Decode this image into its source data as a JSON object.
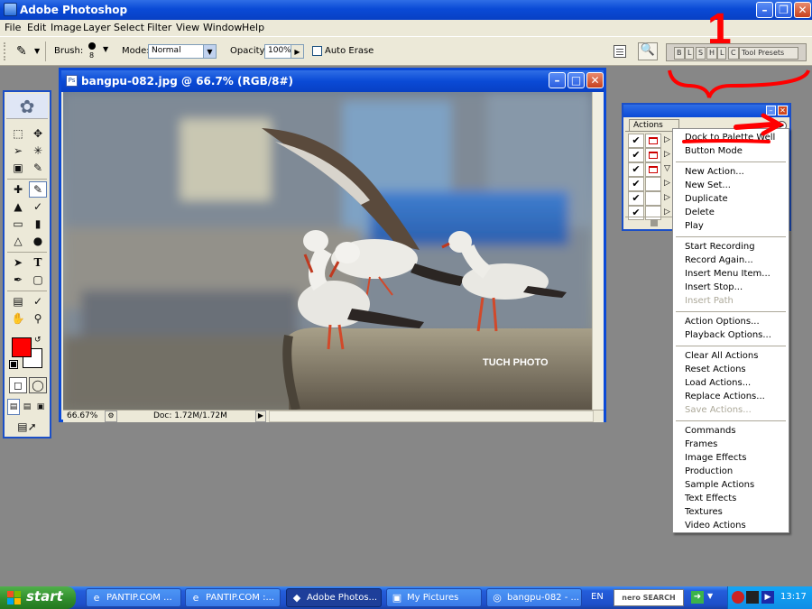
{
  "app": {
    "title": "Adobe Photoshop"
  },
  "menubar": [
    "File",
    "Edit",
    "Image",
    "Layer",
    "Select",
    "Filter",
    "View",
    "Window",
    "Help"
  ],
  "options_bar": {
    "brush_label": "Brush:",
    "brush_size": "8",
    "mode_label": "Mode:",
    "mode_value": "Normal",
    "opacity_label": "Opacity:",
    "opacity_value": "100%",
    "auto_erase_label": "Auto Erase",
    "palette_well_tabs": [
      "B",
      "L",
      "S",
      "H",
      "L",
      "C"
    ],
    "tool_presets_label": "Tool Presets"
  },
  "annotation": {
    "number": "1",
    "color": "#ff0000"
  },
  "document": {
    "title": "bangpu-082.jpg @ 66.7% (RGB/8#)",
    "zoom": "66.67%",
    "doc_size": "Doc: 1.72M/1.72M",
    "watermark": "TUCH PHOTO"
  },
  "actions_palette": {
    "tab_label": "Actions",
    "rows": [
      {
        "checked": true,
        "dialog": true,
        "expanded": false
      },
      {
        "checked": true,
        "dialog": true,
        "expanded": false
      },
      {
        "checked": true,
        "dialog": true,
        "expanded": true
      },
      {
        "checked": true,
        "dialog": false,
        "expanded": false
      },
      {
        "checked": true,
        "dialog": false,
        "expanded": false
      },
      {
        "checked": true,
        "dialog": false,
        "expanded": false
      }
    ]
  },
  "flyout_menu": {
    "groups": [
      [
        {
          "label": "Dock to Palette Well",
          "enabled": true
        },
        {
          "label": "Button Mode",
          "enabled": true
        }
      ],
      [
        {
          "label": "New Action...",
          "enabled": true
        },
        {
          "label": "New Set...",
          "enabled": true
        },
        {
          "label": "Duplicate",
          "enabled": true
        },
        {
          "label": "Delete",
          "enabled": true
        },
        {
          "label": "Play",
          "enabled": true
        }
      ],
      [
        {
          "label": "Start Recording",
          "enabled": true
        },
        {
          "label": "Record Again...",
          "enabled": true
        },
        {
          "label": "Insert Menu Item...",
          "enabled": true
        },
        {
          "label": "Insert Stop...",
          "enabled": true
        },
        {
          "label": "Insert Path",
          "enabled": false
        }
      ],
      [
        {
          "label": "Action Options...",
          "enabled": true
        },
        {
          "label": "Playback Options...",
          "enabled": true
        }
      ],
      [
        {
          "label": "Clear All Actions",
          "enabled": true
        },
        {
          "label": "Reset Actions",
          "enabled": true
        },
        {
          "label": "Load Actions...",
          "enabled": true
        },
        {
          "label": "Replace Actions...",
          "enabled": true
        },
        {
          "label": "Save Actions...",
          "enabled": false
        }
      ],
      [
        {
          "label": "Commands",
          "enabled": true
        },
        {
          "label": "Frames",
          "enabled": true
        },
        {
          "label": "Image Effects",
          "enabled": true
        },
        {
          "label": "Production",
          "enabled": true
        },
        {
          "label": "Sample Actions",
          "enabled": true
        },
        {
          "label": "Text Effects",
          "enabled": true
        },
        {
          "label": "Textures",
          "enabled": true
        },
        {
          "label": "Video Actions",
          "enabled": true
        }
      ]
    ]
  },
  "taskbar": {
    "start_label": "start",
    "tasks": [
      {
        "label": "PANTIP.COM ...",
        "icon": "ie-icon",
        "active": false
      },
      {
        "label": "PANTIP.COM :...",
        "icon": "ie-icon",
        "active": false
      },
      {
        "label": "Adobe Photos...",
        "icon": "photoshop-icon",
        "active": true
      },
      {
        "label": "My Pictures",
        "icon": "folder-icon",
        "active": false
      },
      {
        "label": "bangpu-082 - ...",
        "icon": "image-viewer-icon",
        "active": false
      }
    ],
    "language": "EN",
    "search_label": "nero SEARCH",
    "clock": "13:17"
  }
}
